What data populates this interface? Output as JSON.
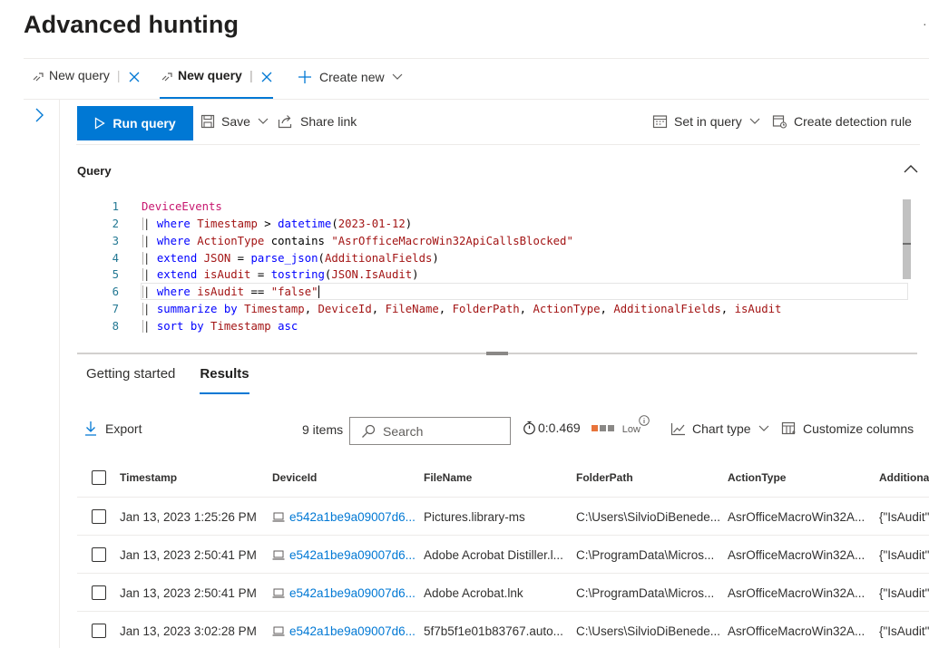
{
  "page": {
    "title": "Advanced hunting"
  },
  "query_tabs": [
    {
      "label": "New query",
      "active": false
    },
    {
      "label": "New query",
      "active": true
    }
  ],
  "create_new_label": "Create new",
  "toolbar": {
    "run_query": "Run query",
    "save": "Save",
    "share_link": "Share link",
    "set_in_query": "Set in query",
    "create_detection_rule": "Create detection rule"
  },
  "query_section": {
    "label": "Query"
  },
  "editor": {
    "line_numbers": [
      "1",
      "2",
      "3",
      "4",
      "5",
      "6",
      "7",
      "8"
    ],
    "lines": [
      "DeviceEvents",
      "| where Timestamp > datetime(2023-01-12)",
      "| where ActionType contains \"AsrOfficeMacroWin32ApiCallsBlocked\"",
      "| extend JSON = parse_json(AdditionalFields)",
      "| extend isAudit = tostring(JSON.IsAudit)",
      "| where isAudit == \"false\"",
      "| summarize by Timestamp, DeviceId, FileName, FolderPath, ActionType, AdditionalFields, isAudit",
      "| sort by Timestamp asc"
    ]
  },
  "results_tabs": [
    {
      "label": "Getting started",
      "active": false
    },
    {
      "label": "Results",
      "active": true
    }
  ],
  "results_toolbar": {
    "export": "Export",
    "items_count": "9 items",
    "search_placeholder": "Search",
    "elapsed": "0:0.469",
    "resource_level": "Low",
    "chart_type": "Chart type",
    "customize_columns": "Customize columns"
  },
  "table": {
    "columns": [
      "Timestamp",
      "DeviceId",
      "FileName",
      "FolderPath",
      "ActionType",
      "Additional"
    ],
    "rows": [
      {
        "timestamp": "Jan 13, 2023 1:25:26 PM",
        "device_id": "e542a1be9a09007d6...",
        "file_name": "Pictures.library-ms",
        "folder_path": "C:\\Users\\SilvioDiBenede...",
        "action_type": "AsrOfficeMacroWin32A...",
        "additional": "{\"IsAudit\":"
      },
      {
        "timestamp": "Jan 13, 2023 2:50:41 PM",
        "device_id": "e542a1be9a09007d6...",
        "file_name": "Adobe Acrobat Distiller.l...",
        "folder_path": "C:\\ProgramData\\Micros...",
        "action_type": "AsrOfficeMacroWin32A...",
        "additional": "{\"IsAudit\":"
      },
      {
        "timestamp": "Jan 13, 2023 2:50:41 PM",
        "device_id": "e542a1be9a09007d6...",
        "file_name": "Adobe Acrobat.lnk",
        "folder_path": "C:\\ProgramData\\Micros...",
        "action_type": "AsrOfficeMacroWin32A...",
        "additional": "{\"IsAudit\":"
      },
      {
        "timestamp": "Jan 13, 2023 3:02:28 PM",
        "device_id": "e542a1be9a09007d6...",
        "file_name": "5f7b5f1e01b83767.auto...",
        "folder_path": "C:\\Users\\SilvioDiBenede...",
        "action_type": "AsrOfficeMacroWin32A...",
        "additional": "{\"IsAudit\":"
      }
    ]
  },
  "colors": {
    "accent": "#0078d4",
    "resource_bar_used": "#e8743b",
    "resource_bar_free": "#8a8886"
  }
}
